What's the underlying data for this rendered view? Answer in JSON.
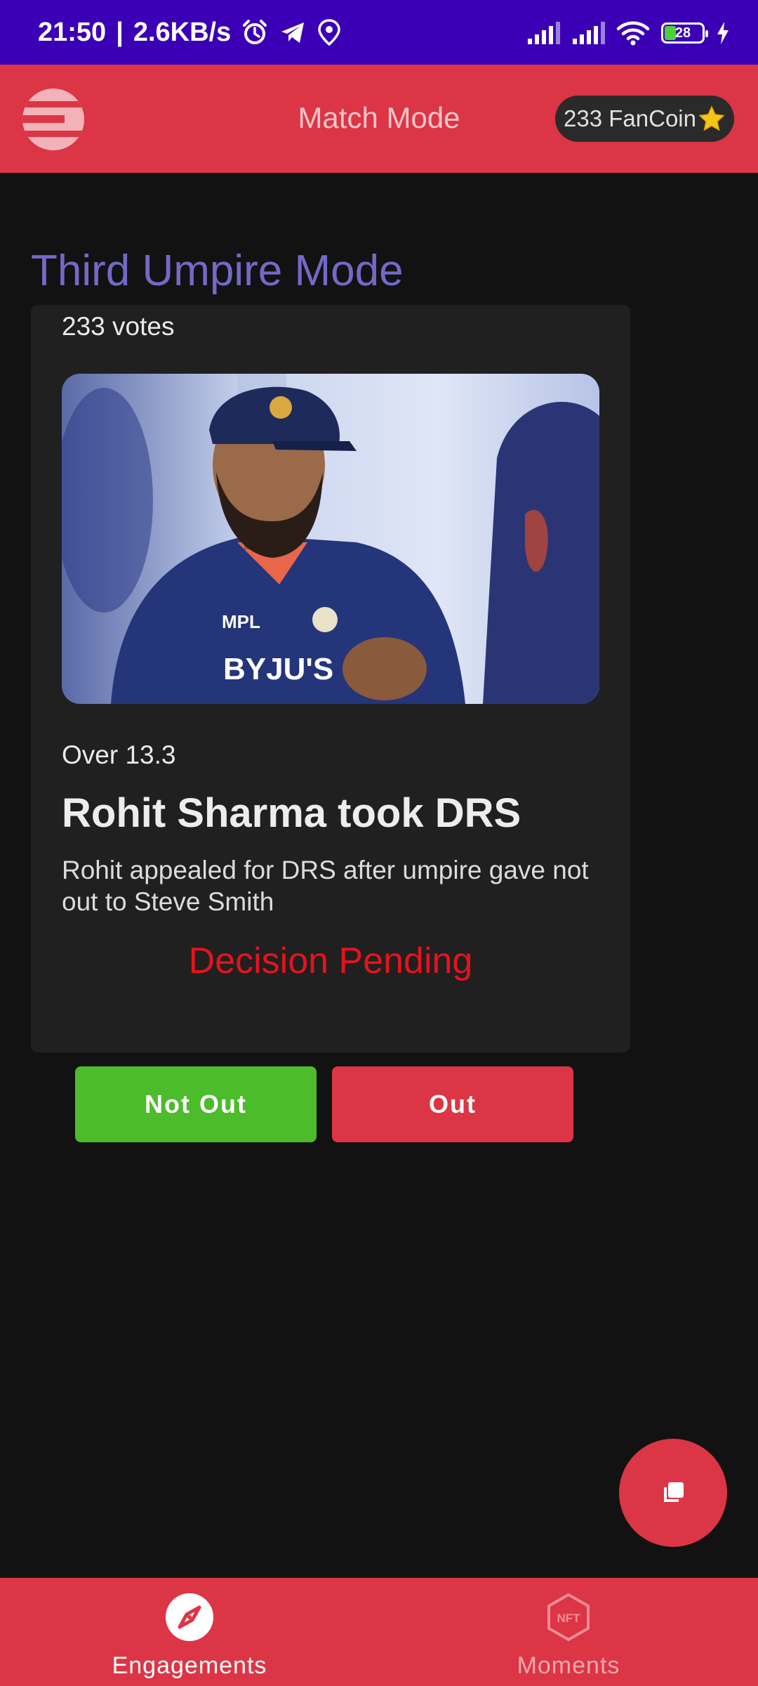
{
  "status_bar": {
    "time": "21:50",
    "separator": "|",
    "speed": "2.6KB/s",
    "battery_level": "28",
    "icons": [
      "alarm-icon",
      "telegram-icon",
      "location-icon",
      "signal-icon",
      "signal-icon",
      "wifi-icon",
      "battery-icon",
      "charging-icon"
    ]
  },
  "app_bar": {
    "title": "Match Mode",
    "fancoin_label": "233 FanCoin",
    "fancoin_icon": "star-icon"
  },
  "section_title": "Third Umpire Mode",
  "card": {
    "votes": "233 votes",
    "over": "Over 13.3",
    "headline": "Rohit Sharma took DRS",
    "description": "Rohit appealed for DRS after umpire gave not out to Steve Smith",
    "decision": "Decision Pending",
    "photo_text": {
      "sponsor1": "MPL",
      "sponsor2": "BYJU'S"
    }
  },
  "actions": {
    "not_out_label": "Not Out",
    "out_label": "Out"
  },
  "bottom_nav": {
    "items": [
      {
        "label": "Engagements",
        "icon": "compass-icon",
        "active": true
      },
      {
        "label": "Moments",
        "icon": "nft-icon",
        "icon_text": "NFT",
        "active": false
      }
    ]
  },
  "colors": {
    "status_bar": "#3b00b6",
    "accent": "#dc3545",
    "background": "#121212",
    "card": "#202020",
    "section_title": "#7469c7",
    "decision": "#e5131d",
    "not_out": "#4cbb2c"
  }
}
